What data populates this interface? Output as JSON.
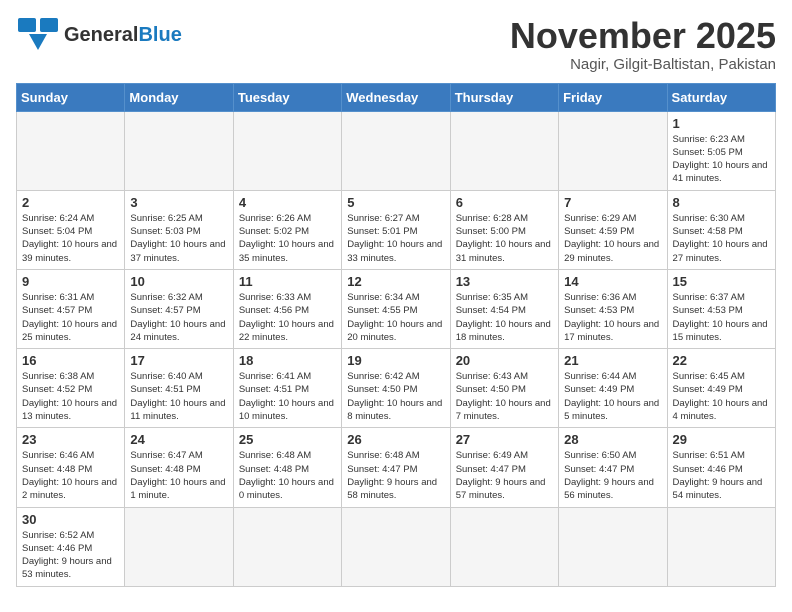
{
  "header": {
    "logo_general": "General",
    "logo_blue": "Blue",
    "month_title": "November 2025",
    "location": "Nagir, Gilgit-Baltistan, Pakistan"
  },
  "weekdays": [
    "Sunday",
    "Monday",
    "Tuesday",
    "Wednesday",
    "Thursday",
    "Friday",
    "Saturday"
  ],
  "weeks": [
    [
      {
        "day": "",
        "info": ""
      },
      {
        "day": "",
        "info": ""
      },
      {
        "day": "",
        "info": ""
      },
      {
        "day": "",
        "info": ""
      },
      {
        "day": "",
        "info": ""
      },
      {
        "day": "",
        "info": ""
      },
      {
        "day": "1",
        "info": "Sunrise: 6:23 AM\nSunset: 5:05 PM\nDaylight: 10 hours and 41 minutes."
      }
    ],
    [
      {
        "day": "2",
        "info": "Sunrise: 6:24 AM\nSunset: 5:04 PM\nDaylight: 10 hours and 39 minutes."
      },
      {
        "day": "3",
        "info": "Sunrise: 6:25 AM\nSunset: 5:03 PM\nDaylight: 10 hours and 37 minutes."
      },
      {
        "day": "4",
        "info": "Sunrise: 6:26 AM\nSunset: 5:02 PM\nDaylight: 10 hours and 35 minutes."
      },
      {
        "day": "5",
        "info": "Sunrise: 6:27 AM\nSunset: 5:01 PM\nDaylight: 10 hours and 33 minutes."
      },
      {
        "day": "6",
        "info": "Sunrise: 6:28 AM\nSunset: 5:00 PM\nDaylight: 10 hours and 31 minutes."
      },
      {
        "day": "7",
        "info": "Sunrise: 6:29 AM\nSunset: 4:59 PM\nDaylight: 10 hours and 29 minutes."
      },
      {
        "day": "8",
        "info": "Sunrise: 6:30 AM\nSunset: 4:58 PM\nDaylight: 10 hours and 27 minutes."
      }
    ],
    [
      {
        "day": "9",
        "info": "Sunrise: 6:31 AM\nSunset: 4:57 PM\nDaylight: 10 hours and 25 minutes."
      },
      {
        "day": "10",
        "info": "Sunrise: 6:32 AM\nSunset: 4:57 PM\nDaylight: 10 hours and 24 minutes."
      },
      {
        "day": "11",
        "info": "Sunrise: 6:33 AM\nSunset: 4:56 PM\nDaylight: 10 hours and 22 minutes."
      },
      {
        "day": "12",
        "info": "Sunrise: 6:34 AM\nSunset: 4:55 PM\nDaylight: 10 hours and 20 minutes."
      },
      {
        "day": "13",
        "info": "Sunrise: 6:35 AM\nSunset: 4:54 PM\nDaylight: 10 hours and 18 minutes."
      },
      {
        "day": "14",
        "info": "Sunrise: 6:36 AM\nSunset: 4:53 PM\nDaylight: 10 hours and 17 minutes."
      },
      {
        "day": "15",
        "info": "Sunrise: 6:37 AM\nSunset: 4:53 PM\nDaylight: 10 hours and 15 minutes."
      }
    ],
    [
      {
        "day": "16",
        "info": "Sunrise: 6:38 AM\nSunset: 4:52 PM\nDaylight: 10 hours and 13 minutes."
      },
      {
        "day": "17",
        "info": "Sunrise: 6:40 AM\nSunset: 4:51 PM\nDaylight: 10 hours and 11 minutes."
      },
      {
        "day": "18",
        "info": "Sunrise: 6:41 AM\nSunset: 4:51 PM\nDaylight: 10 hours and 10 minutes."
      },
      {
        "day": "19",
        "info": "Sunrise: 6:42 AM\nSunset: 4:50 PM\nDaylight: 10 hours and 8 minutes."
      },
      {
        "day": "20",
        "info": "Sunrise: 6:43 AM\nSunset: 4:50 PM\nDaylight: 10 hours and 7 minutes."
      },
      {
        "day": "21",
        "info": "Sunrise: 6:44 AM\nSunset: 4:49 PM\nDaylight: 10 hours and 5 minutes."
      },
      {
        "day": "22",
        "info": "Sunrise: 6:45 AM\nSunset: 4:49 PM\nDaylight: 10 hours and 4 minutes."
      }
    ],
    [
      {
        "day": "23",
        "info": "Sunrise: 6:46 AM\nSunset: 4:48 PM\nDaylight: 10 hours and 2 minutes."
      },
      {
        "day": "24",
        "info": "Sunrise: 6:47 AM\nSunset: 4:48 PM\nDaylight: 10 hours and 1 minute."
      },
      {
        "day": "25",
        "info": "Sunrise: 6:48 AM\nSunset: 4:48 PM\nDaylight: 10 hours and 0 minutes."
      },
      {
        "day": "26",
        "info": "Sunrise: 6:48 AM\nSunset: 4:47 PM\nDaylight: 9 hours and 58 minutes."
      },
      {
        "day": "27",
        "info": "Sunrise: 6:49 AM\nSunset: 4:47 PM\nDaylight: 9 hours and 57 minutes."
      },
      {
        "day": "28",
        "info": "Sunrise: 6:50 AM\nSunset: 4:47 PM\nDaylight: 9 hours and 56 minutes."
      },
      {
        "day": "29",
        "info": "Sunrise: 6:51 AM\nSunset: 4:46 PM\nDaylight: 9 hours and 54 minutes."
      }
    ],
    [
      {
        "day": "30",
        "info": "Sunrise: 6:52 AM\nSunset: 4:46 PM\nDaylight: 9 hours and 53 minutes."
      },
      {
        "day": "",
        "info": ""
      },
      {
        "day": "",
        "info": ""
      },
      {
        "day": "",
        "info": ""
      },
      {
        "day": "",
        "info": ""
      },
      {
        "day": "",
        "info": ""
      },
      {
        "day": "",
        "info": ""
      }
    ]
  ]
}
